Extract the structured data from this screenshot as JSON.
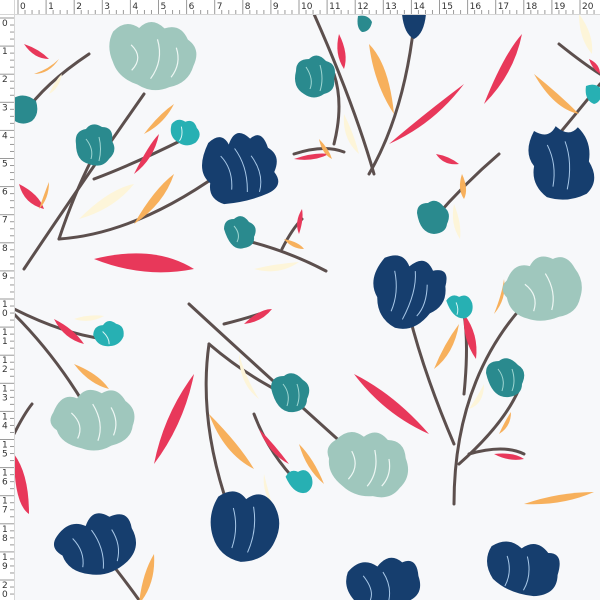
{
  "ruler": {
    "top_labels": [
      "0",
      "1",
      "2",
      "3",
      "4",
      "5",
      "6",
      "7",
      "8",
      "9",
      "10",
      "11",
      "12",
      "13",
      "14",
      "15",
      "16",
      "17",
      "18",
      "19",
      "20"
    ],
    "left_labels": [
      "0",
      "1",
      "2",
      "3",
      "4",
      "5",
      "6",
      "7",
      "8",
      "9",
      "1 0",
      "1 1",
      "1 2",
      "1 3",
      "1 4",
      "1 5",
      "1 6",
      "1 7",
      "1 8",
      "1 9",
      "2 0"
    ]
  },
  "palette": {
    "background": "#f7f8fa",
    "stem": "#5c4f4d",
    "red_leaf": "#e8385a",
    "orange_leaf": "#f7b05c",
    "cream_leaf": "#fdf5d9",
    "navy_flower": "#163e6e",
    "teal_flower": "#2a8a8e",
    "mint_flower": "#9fc7bd",
    "cyan_flower": "#27b0b3"
  },
  "motif": {
    "flower_kinds": [
      "navy-tulip",
      "teal-floret",
      "sage-bloom",
      "cyan-bud"
    ],
    "leaf_kinds": [
      "red-leaf",
      "orange-leaf",
      "cream-leaf"
    ]
  }
}
